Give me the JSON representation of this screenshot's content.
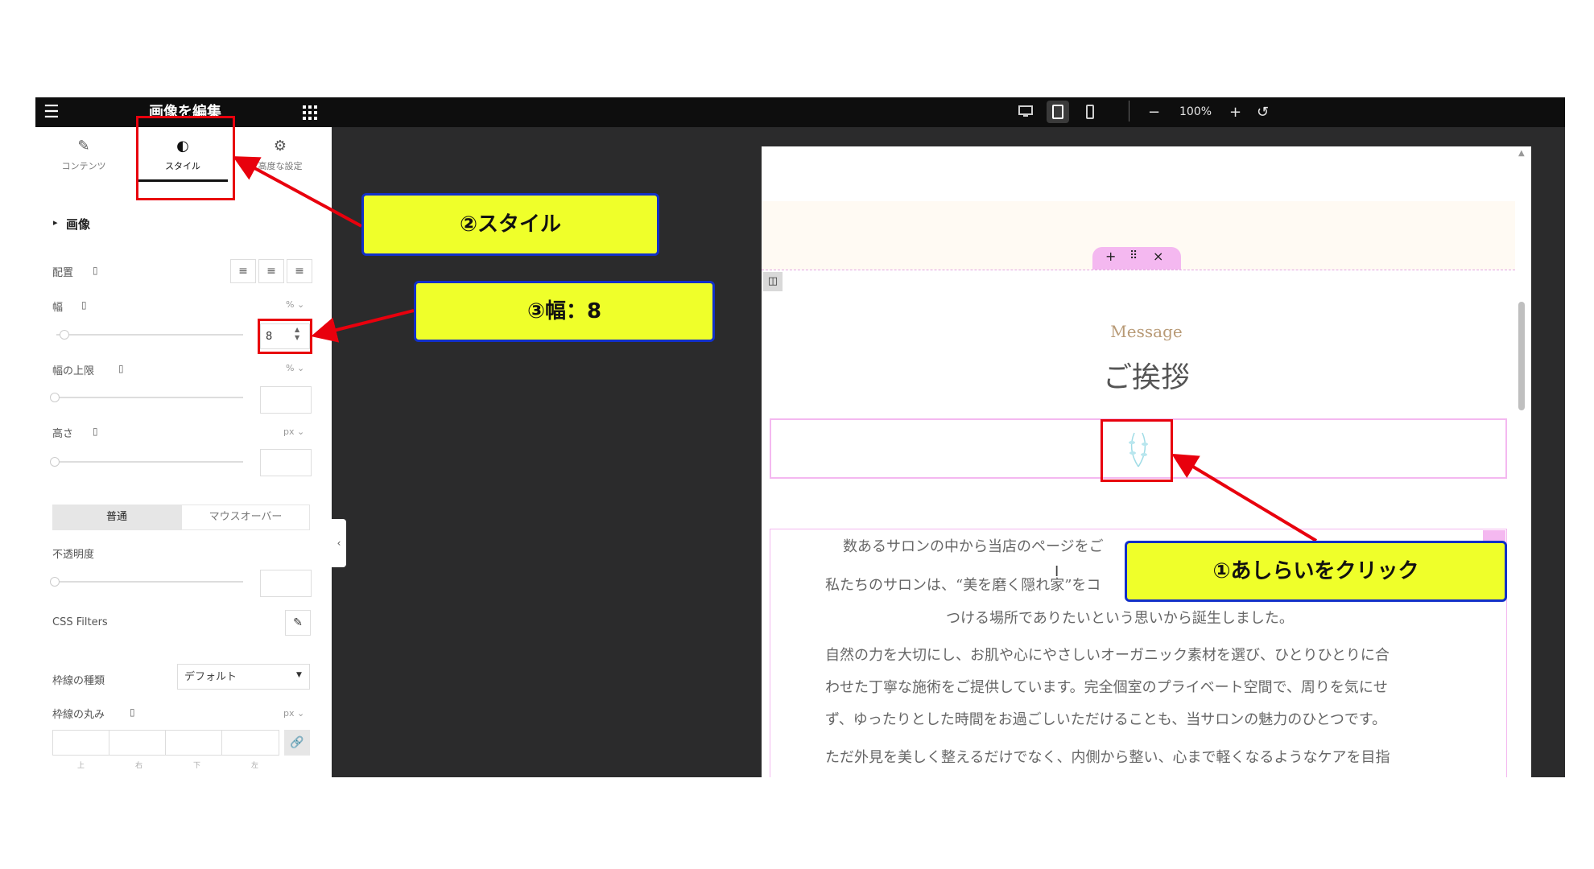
{
  "topbar": {
    "panel_title": "画像を編集",
    "menu_icon": "hamburger-icon",
    "grid_icon": "apps-grid-icon",
    "devices": [
      "desktop-icon",
      "tablet-icon",
      "mobile-icon"
    ],
    "zoom": "100%",
    "zoom_minus": "−",
    "zoom_plus": "+",
    "reset": "↺"
  },
  "panel": {
    "tabs": [
      {
        "label": "コンテンツ",
        "icon": "pencil-icon"
      },
      {
        "label": "スタイル",
        "icon": "contrast-icon"
      },
      {
        "label": "高度な設定",
        "icon": "gear-icon"
      }
    ],
    "section": "画像",
    "align_label": "配置",
    "width_label": "幅",
    "width_unit": "% ⌄",
    "width_value": "8",
    "max_width_label": "幅の上限",
    "max_width_unit": "% ⌄",
    "height_label": "高さ",
    "height_unit": "px ⌄",
    "state_tabs": [
      "普通",
      "マウスオーバー"
    ],
    "opacity_label": "不透明度",
    "css_filters_label": "CSS Filters",
    "border_type_label": "枠線の種類",
    "border_type_value": "デフォルト",
    "border_radius_label": "枠線の丸み",
    "border_radius_unit": "px ⌄",
    "dim_labels": [
      "上",
      "右",
      "下",
      "左"
    ]
  },
  "callouts": {
    "style": "②スタイル",
    "width": "③幅：8",
    "click": "①あしらいをクリック"
  },
  "preview": {
    "toolbar": [
      "+",
      "⠿",
      "×"
    ],
    "heading_en": "Message",
    "heading_jp": "ご挨拶",
    "lines": [
      "数あるサロンの中から当店のページをご",
      "私たちのサロンは、“美を磨く隠れ家”をコ",
      "つける場所でありたいという思いから誕生しました。",
      "自然の力を大切にし、お肌や心にやさしいオーガニック素材を選び、ひとりひとりに合",
      "わせた丁寧な施術をご提供しています。完全個室のプライベート空間で、周りを気にせ",
      "ず、ゆったりとした時間をお過ごしいただけることも、当サロンの魅力のひとつです。",
      "ただ外見を美しく整えるだけでなく、内側から整い、心まで軽くなるようなケアを目指"
    ]
  },
  "colors": {
    "topbar": "#0e0e0e",
    "canvas": "#2b2b2c",
    "callout_fill": "#efff2a",
    "callout_border": "#1230c8",
    "annotation_red": "#e8000d",
    "accent_pink": "#f4b8f0"
  }
}
